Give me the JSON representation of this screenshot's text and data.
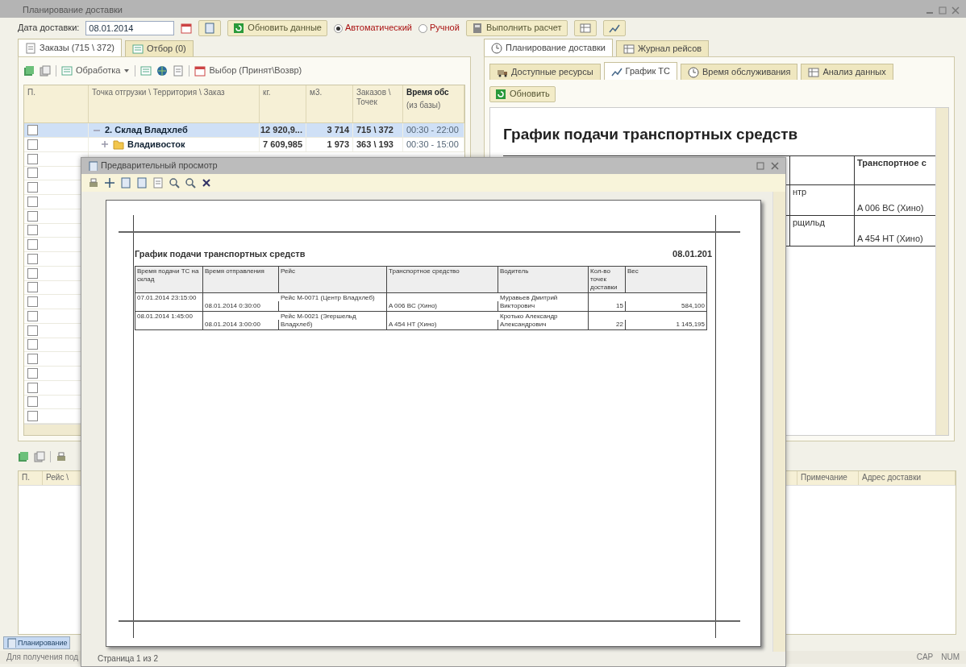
{
  "window": {
    "title": "Планирование доставки"
  },
  "toolbar": {
    "date_label": "Дата доставки:",
    "date_value": "08.01.2014",
    "refresh_button": "Обновить данные",
    "modes": [
      {
        "label": "Автоматический",
        "selected": true
      },
      {
        "label": "Ручной",
        "selected": false
      }
    ],
    "calculate_button": "Выполнить расчет"
  },
  "left_tabs": [
    {
      "label": "Заказы (715 \\ 372)",
      "selected": true
    },
    {
      "label": "Отбор (0)",
      "selected": false
    }
  ],
  "orders_toolbar": {
    "processing_menu": "Обработка",
    "choice_button": "Выбор (Принят\\Возвр)"
  },
  "orders_table": {
    "columns": [
      "П.",
      "Точка отгрузки \\ Территория \\ Заказ",
      "кг.",
      "м3.",
      "Заказов \\ Точек",
      "Время обс"
    ],
    "column_6_subtitle": "(из базы)",
    "rows": [
      {
        "checked": false,
        "selected": true,
        "kind": "warehouse",
        "name": "2. Склад Владхлеб",
        "kg": "12 920,9...",
        "m3": "3 714",
        "orders": "715 \\ 372",
        "time": "00:30 - 22:00"
      },
      {
        "checked": false,
        "selected": false,
        "kind": "territory",
        "name": "Владивосток",
        "kg": "7 609,985",
        "m3": "1 973",
        "orders": "363 \\ 193",
        "time": "00:30 - 15:00"
      }
    ],
    "covered_rows": [
      {
        "checked": false
      },
      {
        "checked": false
      },
      {
        "checked": false
      },
      {
        "checked": false
      },
      {
        "checked": false
      },
      {
        "checked": false
      },
      {
        "checked": false
      },
      {
        "checked": false
      },
      {
        "checked": false
      },
      {
        "checked": false
      },
      {
        "checked": false
      },
      {
        "checked": false
      },
      {
        "checked": false
      },
      {
        "checked": false
      },
      {
        "checked": false
      },
      {
        "checked": false
      },
      {
        "checked": false
      },
      {
        "checked": false
      },
      {
        "checked": false
      }
    ]
  },
  "right_tabs": [
    {
      "label": "Планирование доставки",
      "selected": true
    },
    {
      "label": "Журнал рейсов",
      "selected": false
    }
  ],
  "sub_tabs": [
    {
      "label": "Доступные ресурсы",
      "selected": false
    },
    {
      "label": "График ТС",
      "selected": true
    },
    {
      "label": "Время обслуживания",
      "selected": false
    },
    {
      "label": "Анализ данных",
      "selected": false
    }
  ],
  "update_button": "Обновить",
  "report": {
    "title": "График подачи транспортных средств",
    "column_3": "Транспортное с",
    "rows": [
      {
        "trip_tail": "нтр",
        "vehicle": "A 006 BC (Хино)"
      },
      {
        "trip_tail": "рщильд",
        "vehicle": "A 454 HT (Хино)"
      }
    ]
  },
  "trips_table": {
    "columns_left": [
      "П.",
      "Рейс \\"
    ],
    "columns_right": [
      "Примечание",
      "Адрес доставки"
    ]
  },
  "taskbar": [
    {
      "label": "Планирование",
      "selected": true
    }
  ],
  "status_bar": {
    "hint": "Для получения под",
    "indicators": [
      "CAP",
      "NUM"
    ]
  },
  "preview": {
    "title": "Предварительный просмотр",
    "status": "Страница 1 из 2",
    "page": {
      "title": "График подачи транспортных средств",
      "date": "08.01.201",
      "columns": [
        "Время подачи ТС на склад",
        "Время отправления",
        "Рейс",
        "Транспортное средство",
        "Водитель",
        "Кол-во точек доставки",
        "Вес"
      ],
      "rows": [
        [
          "07.01.2014 23:15:00",
          "08.01.2014 0:30:00",
          "Рейс М-0071 (Центр Владхлеб)",
          "A 006 BC (Хино)",
          "Муравьев Дмитрий Викторович",
          "15",
          "584,100"
        ],
        [
          "08.01.2014 1:45:00",
          "08.01.2014 3:00:00",
          "Рейс М-0021 (Эгершельд Владхлеб)",
          "A 454 HT (Хино)",
          "Кротько Александр Александрович",
          "22",
          "1 145,195"
        ]
      ]
    }
  }
}
